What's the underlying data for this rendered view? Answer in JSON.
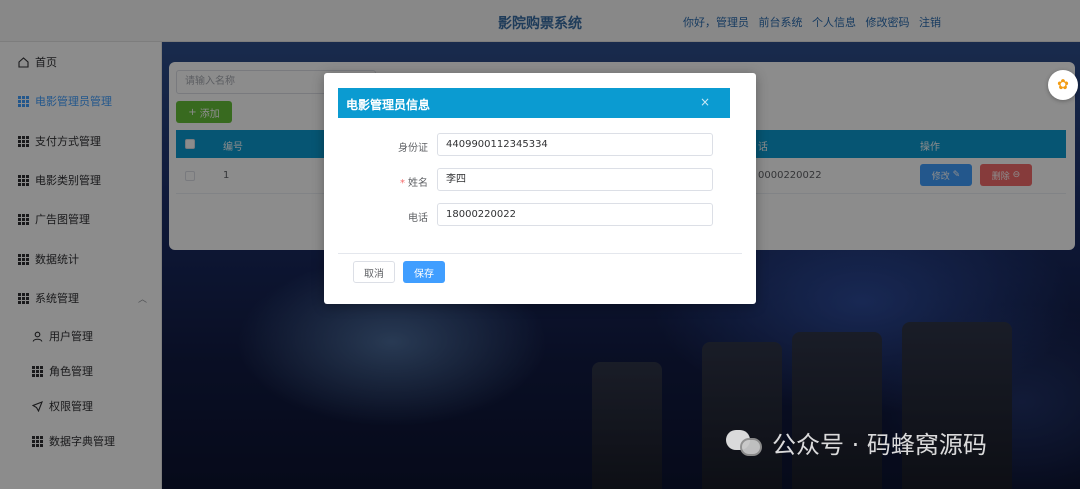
{
  "header": {
    "title": "影院购票系统",
    "links": [
      "你好，管理员",
      "前台系统",
      "个人信息",
      "修改密码",
      "注销"
    ]
  },
  "sidebar": {
    "items": [
      {
        "label": "首页",
        "icon": "home-icon"
      },
      {
        "label": "电影管理员管理",
        "icon": "grid-icon",
        "active": true
      },
      {
        "label": "支付方式管理",
        "icon": "grid-icon"
      },
      {
        "label": "电影类别管理",
        "icon": "grid-icon"
      },
      {
        "label": "广告图管理",
        "icon": "grid-icon"
      },
      {
        "label": "数据统计",
        "icon": "grid-icon"
      },
      {
        "label": "系统管理",
        "icon": "grid-icon",
        "expanded": true
      }
    ],
    "sub_items": [
      {
        "label": "用户管理",
        "icon": "user-icon"
      },
      {
        "label": "角色管理",
        "icon": "grid-icon"
      },
      {
        "label": "权限管理",
        "icon": "send-icon"
      },
      {
        "label": "数据字典管理",
        "icon": "grid-icon"
      }
    ]
  },
  "content": {
    "search_placeholder": "请输入名称",
    "add_button": "添加",
    "columns": [
      "编号",
      "话",
      "操作"
    ],
    "rows": [
      {
        "id": "1",
        "phone_partial": "0000220022"
      }
    ],
    "edit_button": "修改",
    "delete_button": "删除"
  },
  "dialog": {
    "title": "电影管理员信息",
    "close_symbol": "×",
    "fields": [
      {
        "label": "身份证",
        "value": "4409900112345334",
        "required": false
      },
      {
        "label": "姓名",
        "value": "李四",
        "required": true
      },
      {
        "label": "电话",
        "value": "18000220022",
        "required": false
      }
    ],
    "cancel_label": "取消",
    "save_label": "保存"
  },
  "watermark": {
    "text": "公众号 · 码蜂窝源码"
  },
  "colors": {
    "header_blue": "#0b9bd1",
    "primary": "#409eff",
    "success": "#67c23a",
    "danger": "#f56c6c"
  }
}
